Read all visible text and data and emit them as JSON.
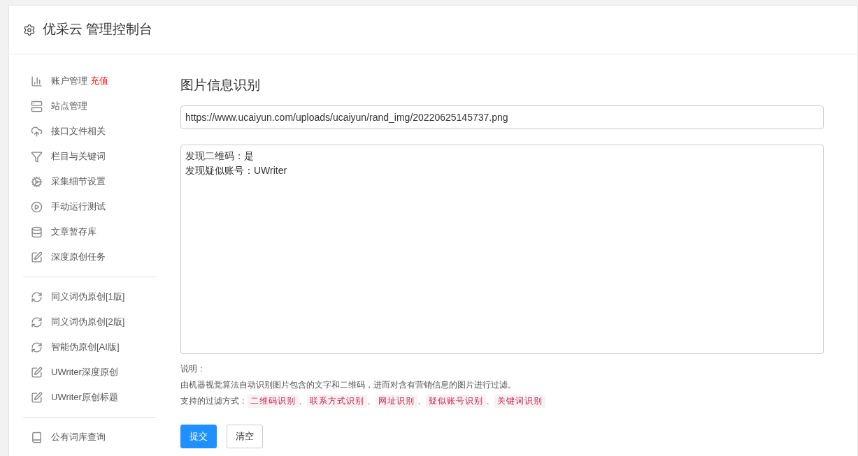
{
  "header": {
    "title": "优采云 管理控制台"
  },
  "sidebar": {
    "groups": [
      {
        "items": [
          {
            "label": "账户管理",
            "badge": "充值"
          },
          {
            "label": "站点管理"
          },
          {
            "label": "接口文件相关"
          },
          {
            "label": "栏目与关键词"
          },
          {
            "label": "采集细节设置"
          },
          {
            "label": "手动运行测试"
          },
          {
            "label": "文章暂存库"
          },
          {
            "label": "深度原创任务"
          }
        ]
      },
      {
        "items": [
          {
            "label": "同义词伪原创[1版]"
          },
          {
            "label": "同义词伪原创[2版]"
          },
          {
            "label": "智能伪原创[AI版]"
          },
          {
            "label": "UWriter深度原创"
          },
          {
            "label": "UWriter原创标题"
          }
        ]
      },
      {
        "items": [
          {
            "label": "公有词库查询"
          }
        ]
      }
    ]
  },
  "main": {
    "title": "图片信息识别",
    "url_field": {
      "value": "https://www.ucaiyun.com/uploads/ucaiyun/rand_img/20220625145737.png"
    },
    "result_box": {
      "lines": [
        "发现二维码：是",
        "发现疑似账号：UWriter"
      ]
    },
    "notes": {
      "heading": "说明：",
      "description": "由机器视觉算法自动识别图片包含的文字和二维码，进而对含有营销信息的图片进行过滤。",
      "filters_label": "支持的过滤方式：",
      "separator": "、",
      "filters": [
        "二维码识别",
        "联系方式识别",
        "网址识别",
        "疑似账号识别",
        "关键词识别"
      ]
    },
    "buttons": [
      {
        "label": "提交",
        "kind": "primary"
      },
      {
        "label": "清空",
        "kind": "default"
      }
    ]
  }
}
